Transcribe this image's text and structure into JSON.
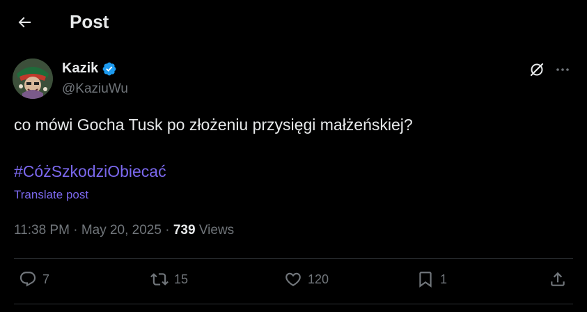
{
  "header": {
    "title": "Post"
  },
  "author": {
    "display_name": "Kazik",
    "handle": "@KaziuWu"
  },
  "post": {
    "text": "co mówi Gocha Tusk po złożeniu przysięgi małżeńskiej?",
    "hashtag": "#CóżSzkodziObiecać",
    "translate_label": "Translate post"
  },
  "meta": {
    "time": "11:38 PM",
    "separator1": " · ",
    "date": "May 20, 2025",
    "separator2": " · ",
    "views": "739",
    "views_label": " Views"
  },
  "actions": {
    "replies": "7",
    "reposts": "15",
    "likes": "120",
    "bookmarks": "1"
  },
  "colors": {
    "background": "#000000",
    "text": "#e7e9ea",
    "muted": "#71767b",
    "link": "#7b68ee",
    "verified": "#1d9bf0",
    "divider": "#2f3336"
  },
  "icons": {
    "back": "arrow-left-icon",
    "verified": "verified-badge-icon",
    "grok": "grok-icon",
    "more": "more-horizontal-icon",
    "reply": "reply-icon",
    "repost": "repost-icon",
    "like": "heart-icon",
    "bookmark": "bookmark-icon",
    "share": "share-icon"
  }
}
